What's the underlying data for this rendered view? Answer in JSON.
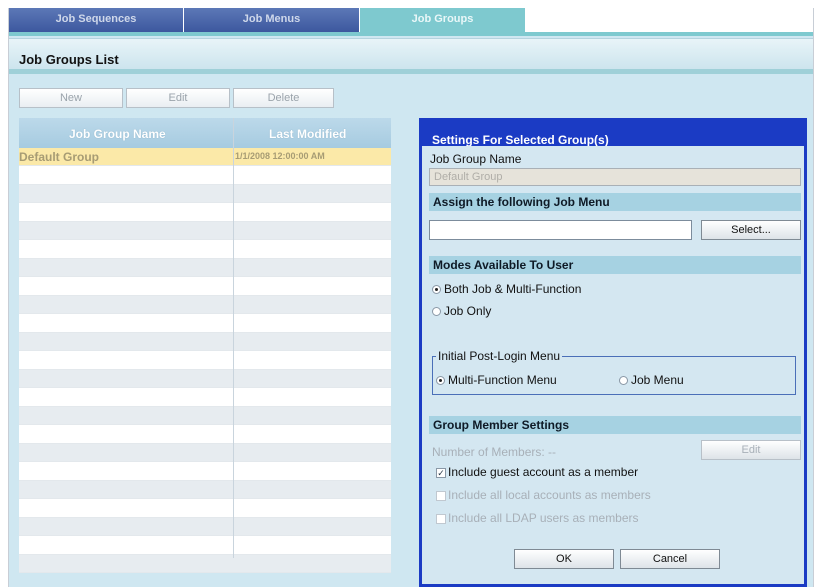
{
  "tabs": [
    {
      "label": "Job Sequences",
      "active": false
    },
    {
      "label": "Job Menus",
      "active": false
    },
    {
      "label": "Job Groups",
      "active": true
    }
  ],
  "page_title": "Job Groups List",
  "toolbar": {
    "new_label": "New",
    "edit_label": "Edit",
    "delete_label": "Delete"
  },
  "table": {
    "headers": [
      "Job Group Name",
      "Last Modified"
    ],
    "rows": [
      {
        "name": "Default Group",
        "modified": "1/1/2008 12:00:00 AM",
        "selected": true
      }
    ]
  },
  "settings": {
    "title": "Settings For Selected Group(s)",
    "group_name_label": "Job Group Name",
    "group_name_value": "Default Group",
    "assign_menu_heading": "Assign the following Job Menu",
    "assign_menu_value": "",
    "select_button": "Select...",
    "modes_heading": "Modes Available To User",
    "modes": [
      {
        "label": "Both Job & Multi-Function",
        "checked": true
      },
      {
        "label": "Job Only",
        "checked": false
      }
    ],
    "post_login_legend": "Initial Post-Login Menu",
    "post_login_options": [
      {
        "label": "Multi-Function Menu",
        "checked": true
      },
      {
        "label": "Job Menu",
        "checked": false
      }
    ],
    "member_heading": "Group Member Settings",
    "members_label": "Number of Members:  --",
    "members_edit_button": "Edit",
    "member_options": [
      {
        "label": "Include guest account as a member",
        "checked": true,
        "enabled": true
      },
      {
        "label": "Include all local accounts as members",
        "checked": false,
        "enabled": false
      },
      {
        "label": "Include all LDAP users as members",
        "checked": false,
        "enabled": false
      }
    ],
    "ok_button": "OK",
    "cancel_button": "Cancel"
  },
  "colors": {
    "panel_border": "#1b3bc4",
    "tab_active": "#7ec9cf",
    "tab_inactive": "#3a559c",
    "selected_row": "#fbe9a8"
  }
}
